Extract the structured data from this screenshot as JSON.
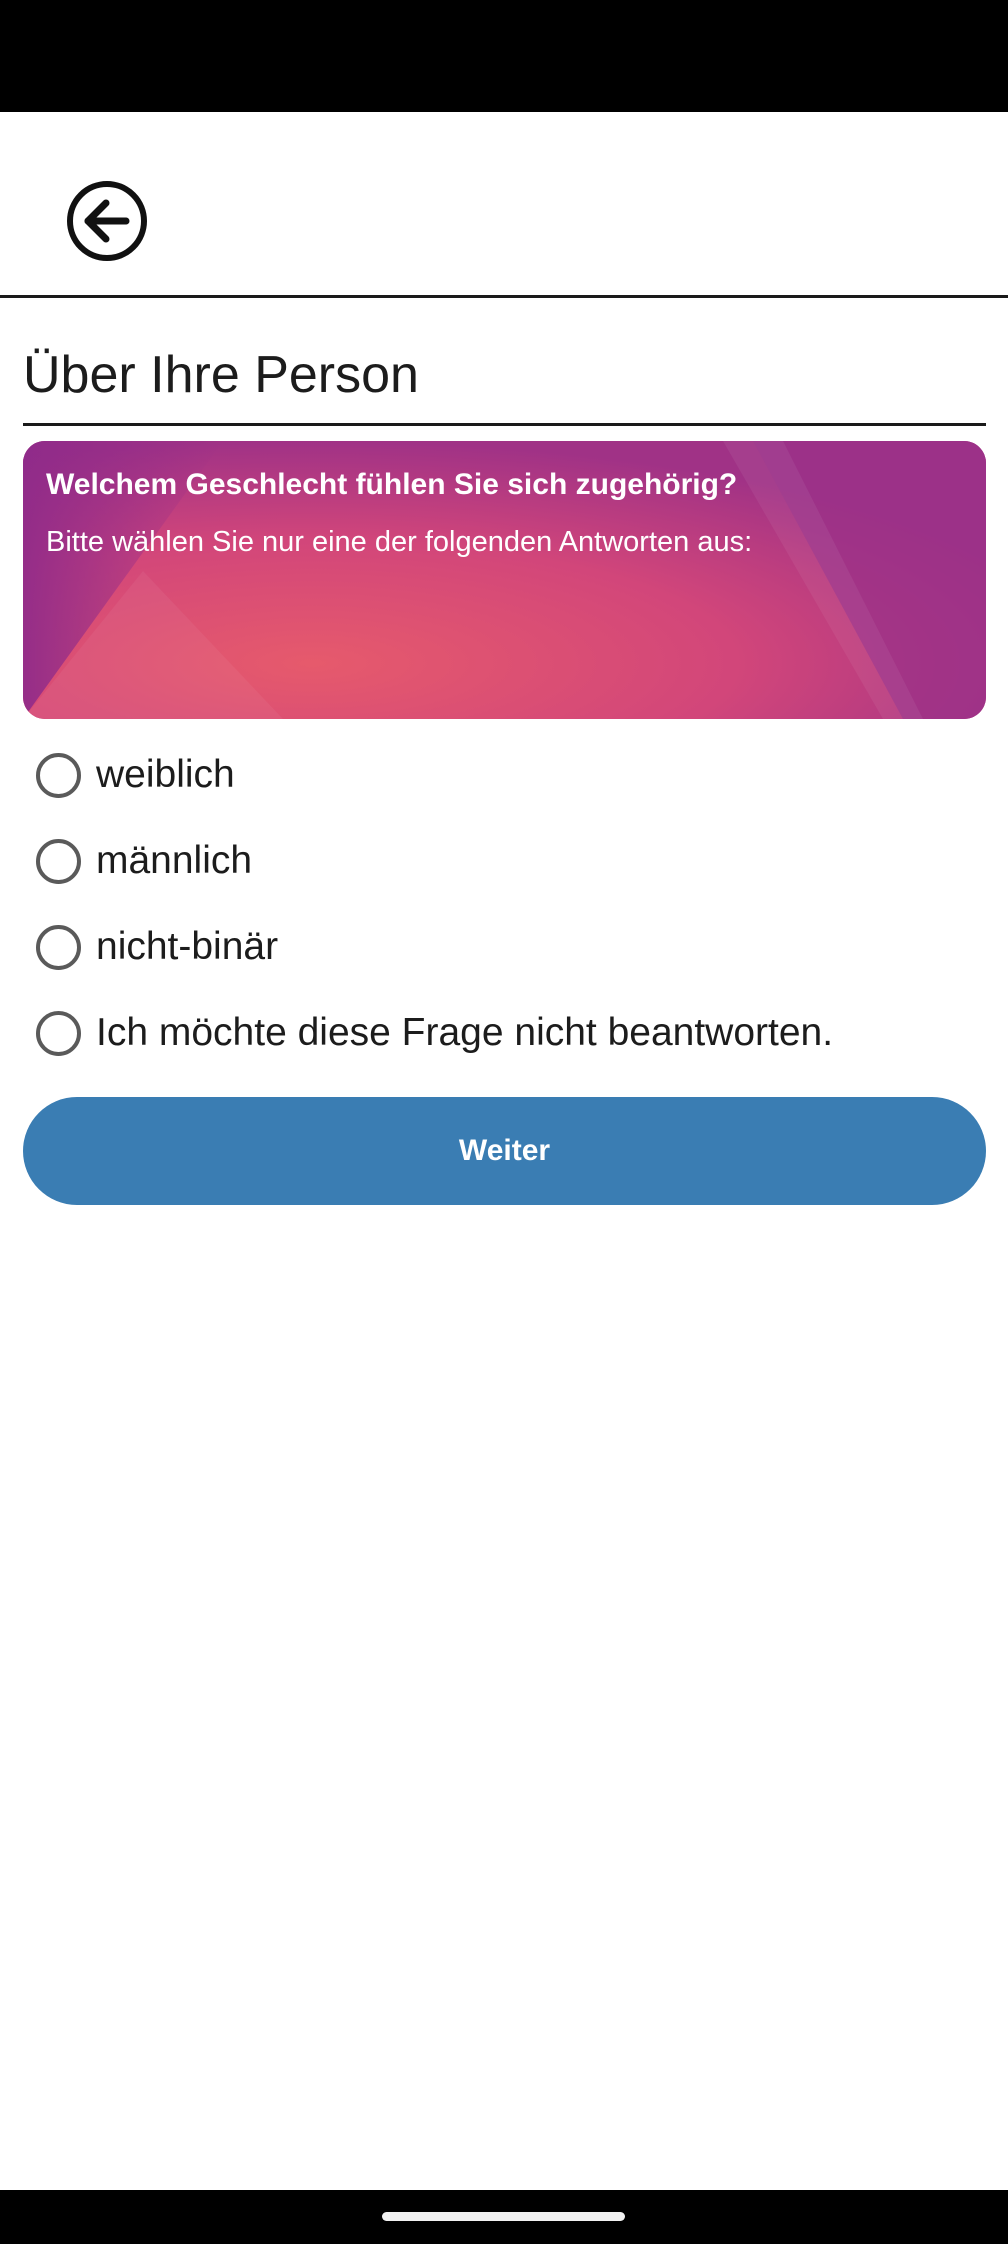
{
  "header": {
    "back_icon": "arrow-left-circle-icon"
  },
  "page": {
    "title": "Über Ihre Person"
  },
  "question": {
    "text": "Welchem Geschlecht fühlen Sie sich zugehörig?",
    "hint": "Bitte wählen Sie nur eine der folgenden Antworten aus:"
  },
  "options": [
    {
      "label": "weiblich",
      "selected": false
    },
    {
      "label": "männlich",
      "selected": false
    },
    {
      "label": "nicht-binär",
      "selected": false
    },
    {
      "label": "Ich möchte diese Frage nicht beantworten.",
      "selected": false
    }
  ],
  "actions": {
    "next_label": "Weiter"
  },
  "colors": {
    "card_gradient_start": "#8e2a8a",
    "card_gradient_mid": "#e2566e",
    "card_gradient_end": "#9a3388",
    "button": "#3a7db3"
  }
}
